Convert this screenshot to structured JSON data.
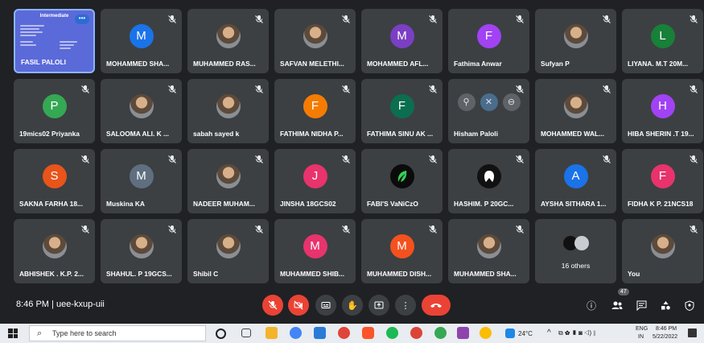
{
  "meeting": {
    "time": "8:46 PM",
    "separator": "|",
    "code": "uee-kxup-uii",
    "participant_badge": "47"
  },
  "presenter": {
    "slide_title": "Intermediate",
    "name": "FASIL PALOLI",
    "dots": "•••"
  },
  "participants": [
    {
      "name": "MOHAMMED SHA...",
      "initial": "M",
      "color": "#1a73e8",
      "photo": false
    },
    {
      "name": "MUHAMMED RAS...",
      "initial": "",
      "color": "",
      "photo": true
    },
    {
      "name": "SAFVAN MELETHI...",
      "initial": "",
      "color": "",
      "photo": true
    },
    {
      "name": "MOHAMMED AFL...",
      "initial": "M",
      "color": "#7b3fc4",
      "photo": false
    },
    {
      "name": "Fathima Anwar",
      "initial": "F",
      "color": "#a142f4",
      "photo": false
    },
    {
      "name": "Sufyan P",
      "initial": "",
      "color": "",
      "photo": true
    },
    {
      "name": "LIYANA. M.T 20M...",
      "initial": "L",
      "color": "#188038",
      "photo": false
    },
    {
      "name": "19mics02 Priyanka",
      "initial": "P",
      "color": "#34a853",
      "photo": false
    },
    {
      "name": "SALOOMA ALI. K ...",
      "initial": "",
      "color": "",
      "photo": true
    },
    {
      "name": "sabah sayed k",
      "initial": "",
      "color": "",
      "photo": true
    },
    {
      "name": "FATHIMA NIDHA P...",
      "initial": "F",
      "color": "#f57c00",
      "photo": false
    },
    {
      "name": "FATHIMA SINU AK ...",
      "initial": "F",
      "color": "#0b6e4f",
      "photo": false
    },
    {
      "name": "Hisham Paloli",
      "initial": "",
      "color": "",
      "photo": false,
      "hover": true
    },
    {
      "name": "MOHAMMED WAL...",
      "initial": "",
      "color": "",
      "photo": true
    },
    {
      "name": "HIBA SHERIN .T 19...",
      "initial": "H",
      "color": "#a142f4",
      "photo": false
    },
    {
      "name": "SAKNA FARHA 18...",
      "initial": "S",
      "color": "#e8541a",
      "photo": false
    },
    {
      "name": "Muskina KA",
      "initial": "M",
      "color": "#5f6f7f",
      "photo": false
    },
    {
      "name": "NADEER MUHAM...",
      "initial": "",
      "color": "",
      "photo": true
    },
    {
      "name": "JINSHA 18GCS02",
      "initial": "J",
      "color": "#e8336d",
      "photo": false
    },
    {
      "name": "FABI'S VaNiCzO",
      "initial": "",
      "color": "#0b0b0b",
      "photo": false,
      "leaf": true
    },
    {
      "name": "HASHIM. P 20GC...",
      "initial": "",
      "color": "#111111",
      "photo": false,
      "bw": true
    },
    {
      "name": "AYSHA SITHARA 1...",
      "initial": "A",
      "color": "#1a73e8",
      "photo": false
    },
    {
      "name": "FIDHA K P. 21NCS18",
      "initial": "F",
      "color": "#e8336d",
      "photo": false
    },
    {
      "name": "ABHISHEK . K.P. 2...",
      "initial": "",
      "color": "",
      "photo": true
    },
    {
      "name": "SHAHUL. P 19GCS...",
      "initial": "",
      "color": "",
      "photo": true
    },
    {
      "name": "Shibil C",
      "initial": "",
      "color": "",
      "photo": true
    },
    {
      "name": "MUHAMMED SHIB...",
      "initial": "M",
      "color": "#e8336d",
      "photo": false
    },
    {
      "name": "MUHAMMED DISH...",
      "initial": "M",
      "color": "#f4511e",
      "photo": false
    },
    {
      "name": "MUHAMMED SHA...",
      "initial": "",
      "color": "",
      "photo": true
    }
  ],
  "others": {
    "label": "16 others"
  },
  "self": {
    "label": "You"
  },
  "taskbar": {
    "search_placeholder": "Type here to search",
    "weather": "24°C",
    "lang1": "ENG",
    "lang2": "IN",
    "clock_time": "8:46 PM",
    "clock_date": "5/22/2022"
  }
}
